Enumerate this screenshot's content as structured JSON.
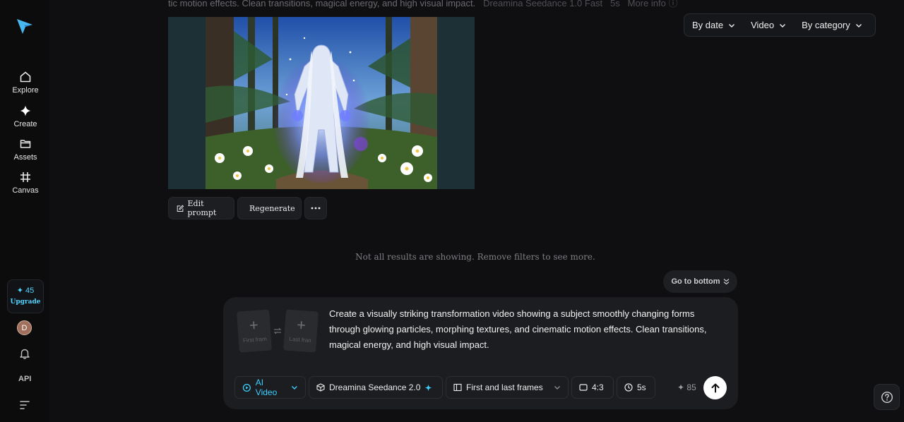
{
  "sidebar": {
    "items": [
      {
        "label": "Explore",
        "icon": "home-icon"
      },
      {
        "label": "Create",
        "icon": "create-diamond-icon"
      },
      {
        "label": "Assets",
        "icon": "folder-icon"
      },
      {
        "label": "Canvas",
        "icon": "canvas-grid-icon"
      }
    ],
    "credits": {
      "amount": "45",
      "upgrade_label": "Upgrade"
    },
    "avatar_initial": "D",
    "api_label": "API"
  },
  "top": {
    "prompt_tail": "tic motion effects. Clean transitions, magical energy, and high visual impact.",
    "model": "Dreamina Seedance 1.0 Fast",
    "duration": "5s",
    "more_info": "More info"
  },
  "filters": [
    {
      "label": "By date"
    },
    {
      "label": "Video"
    },
    {
      "label": "By category"
    }
  ],
  "actions": {
    "edit_prompt": "Edit prompt",
    "regenerate": "Regenerate"
  },
  "notice": "Not all results are showing. Remove filters to see more.",
  "go_bottom": "Go to bottom",
  "composer": {
    "first_frame_label": "First fram",
    "last_frame_label": "Last fran",
    "prompt": "Create a visually striking transformation video showing a subject smoothly changing forms through glowing particles, morphing textures, and cinematic motion effects. Clean transitions, magical energy, and high visual impact.",
    "mode": "AI Video",
    "model": "Dreamina Seedance 2.0",
    "frames_mode": "First and last frames",
    "aspect": "4:3",
    "duration": "5s",
    "cost": "85"
  },
  "colors": {
    "accent": "#3ccfff",
    "background": "#0f0f11"
  }
}
